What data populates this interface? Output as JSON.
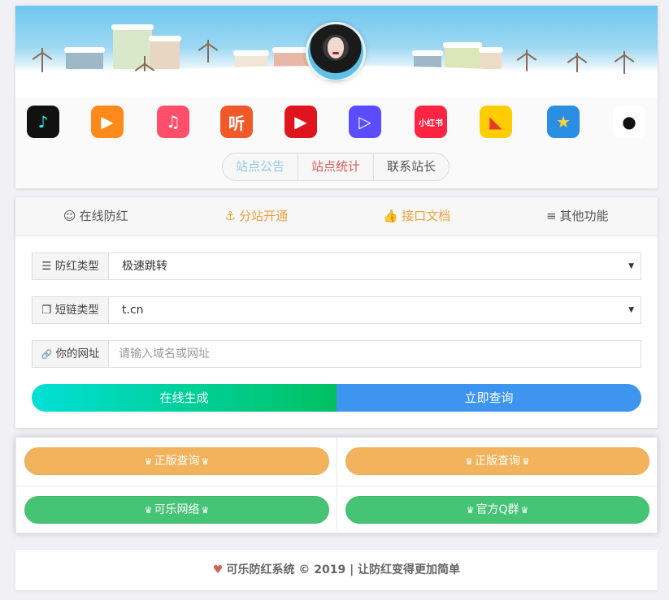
{
  "header": {
    "apps": [
      {
        "name": "tiktok-icon",
        "glyph": "♪",
        "bg": "#111111",
        "fg": "#25f4ee"
      },
      {
        "name": "kuaishou-icon",
        "glyph": "▶",
        "bg": "#ff8a1c",
        "fg": "#ffffff"
      },
      {
        "name": "quanmin-icon",
        "glyph": "♫",
        "bg": "#ff4f6b",
        "fg": "#ffffff"
      },
      {
        "name": "ting-icon",
        "glyph": "听",
        "bg": "#f05a28",
        "fg": "#ffffff"
      },
      {
        "name": "video-play-icon",
        "glyph": "▶",
        "bg": "#e0141e",
        "fg": "#ffffff"
      },
      {
        "name": "tencent-video-icon",
        "glyph": "▷",
        "bg": "#5b4dff",
        "fg": "#ffffff"
      },
      {
        "name": "xiaohongshu-icon",
        "glyph": "小红书",
        "bg": "#ff2442",
        "fg": "#ffffff"
      },
      {
        "name": "fun-face-icon",
        "glyph": "◣",
        "bg": "#ffcc00",
        "fg": "#e83a2a"
      },
      {
        "name": "qzone-icon",
        "glyph": "★",
        "bg": "#2a8fe3",
        "fg": "#ffd43b"
      },
      {
        "name": "qq-icon",
        "glyph": "●",
        "bg": "#ffffff",
        "fg": "#111111"
      }
    ],
    "notice_tabs": [
      {
        "label": "站点公告",
        "color": "#8ecbe6"
      },
      {
        "label": "站点统计",
        "color": "#e25a5a"
      },
      {
        "label": "联系站长",
        "color": "#555555"
      }
    ]
  },
  "nav": {
    "items": [
      {
        "label": "在线防红",
        "icon": "☺",
        "color": "#555555"
      },
      {
        "label": "分站开通",
        "icon": "⚓",
        "color": "#f2a03d"
      },
      {
        "label": "接口文档",
        "icon": "👍",
        "color": "#f2a03d"
      },
      {
        "label": "其他功能",
        "icon": "≡",
        "color": "#555555"
      }
    ]
  },
  "form": {
    "type_label": "防红类型",
    "type_icon": "☰",
    "type_value": "极速跳转",
    "shortlink_label": "短链类型",
    "shortlink_icon": "❐",
    "shortlink_value": "t.cn",
    "url_label": "你的网址",
    "url_icon": "🔗",
    "url_placeholder": "请输入域名或网址",
    "generate_label": "在线生成",
    "query_label": "立即查询"
  },
  "grid": {
    "cells": [
      {
        "label": "正版查询",
        "color": "#f2b35c"
      },
      {
        "label": "正版查询",
        "color": "#f2b35c"
      },
      {
        "label": "可乐网络",
        "color": "#45c476"
      },
      {
        "label": "官方Q群",
        "color": "#45c476"
      }
    ],
    "gift_glyph": "♛"
  },
  "footer": {
    "text": "可乐防红系统 © 2019 | 让防红变得更加简单"
  },
  "colors": {
    "generate_gradient_start": "#00e0d6",
    "generate_gradient_end": "#00c060",
    "query_button": "#3d95ef"
  }
}
